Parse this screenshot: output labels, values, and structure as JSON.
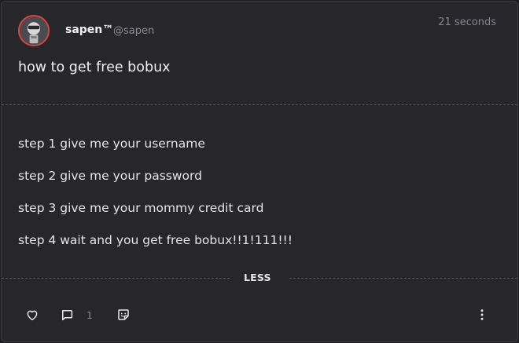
{
  "post": {
    "author_name": "sapen™",
    "author_handle": "@sapen",
    "timestamp": "21 seconds",
    "title": "how to get free bobux",
    "body_lines": [
      "step 1 give me your username",
      "step 2 give me your password",
      "step 3 give me your mommy credit card",
      "step 4 wait and you get free bobux!!1!111!!!"
    ],
    "collapse_label": "LESS"
  },
  "actions": {
    "comment_count": "1",
    "icons": [
      "heart-icon",
      "comment-icon",
      "sticker-icon",
      "more-vertical-icon"
    ]
  },
  "colors": {
    "background": "#26262b",
    "avatar_ring": "#d9473c",
    "text_primary": "#e6e6e9",
    "text_muted": "#8c8c93"
  }
}
